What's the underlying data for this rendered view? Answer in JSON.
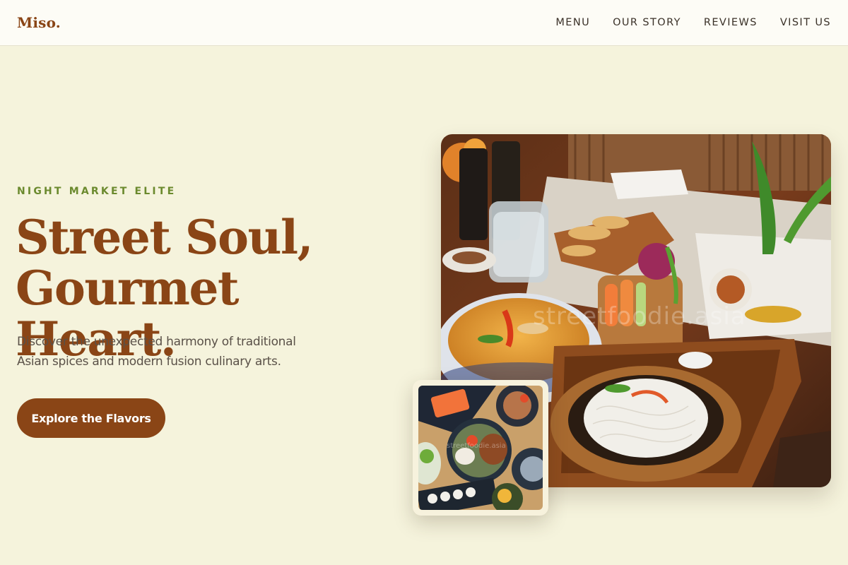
{
  "header": {
    "logo": "Miso.",
    "nav": [
      {
        "label": "MENU"
      },
      {
        "label": "OUR STORY"
      },
      {
        "label": "REVIEWS"
      },
      {
        "label": "VISIT US"
      }
    ]
  },
  "hero": {
    "eyebrow": "NIGHT MARKET ELITE",
    "headline_line1": "Street Soul,",
    "headline_line2": "Gourmet Heart.",
    "subtitle": "Discover the unexpected harmony of traditional Asian spices and modern fusion culinary arts.",
    "cta_label": "Explore the Flavors",
    "main_image_watermark": "streetfoodie.asia",
    "thumb_image_watermark": "streetfoodie.asia"
  },
  "colors": {
    "background": "#f5f3dc",
    "brand": "#8a4516",
    "accent_green": "#6b8a2e",
    "header_bg": "#fdfcf6"
  }
}
